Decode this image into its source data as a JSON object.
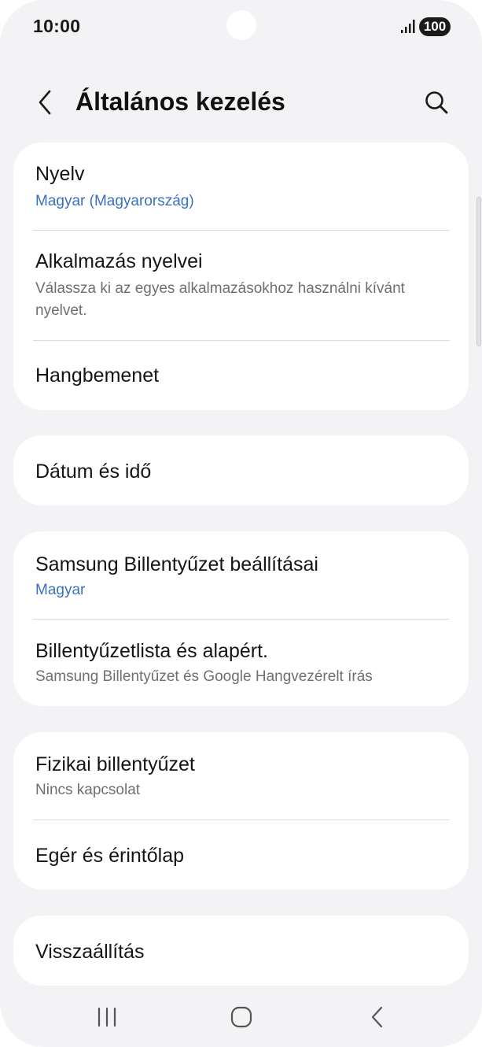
{
  "status_bar": {
    "time": "10:00",
    "battery": "100",
    "icons": [
      "signal-icon",
      "battery-icon",
      "camera-cutout"
    ]
  },
  "header": {
    "title": "Általános kezelés",
    "icons": [
      "back-arrow-icon",
      "search-icon"
    ]
  },
  "groups": [
    {
      "items": [
        {
          "title": "Nyelv",
          "subtitle": "Magyar (Magyarország)"
        },
        {
          "title": "Alkalmazás nyelvei",
          "subtitle": "Válassza ki az egyes alkalmazásokhoz használni kívánt nyelvet."
        },
        {
          "title": "Hangbemenet"
        }
      ]
    },
    {
      "items": [
        {
          "title": "Dátum és idő"
        }
      ]
    },
    {
      "items": [
        {
          "title": "Samsung Billentyűzet beállításai",
          "subtitle": "Magyar"
        },
        {
          "title": "Billentyűzetlista és alapért.",
          "subtitle": "Samsung Billentyűzet és Google Hangvezérelt írás"
        }
      ]
    },
    {
      "items": [
        {
          "title": "Fizikai billentyűzet",
          "subtitle": "Nincs kapcsolat"
        },
        {
          "title": "Egér és érintőlap"
        }
      ]
    },
    {
      "items": [
        {
          "title": "Visszaállítás"
        }
      ]
    }
  ],
  "nav_bar": {
    "icons": [
      "recent-apps-icon",
      "home-icon",
      "back-icon"
    ]
  },
  "colors": {
    "background": "#f3f3f5",
    "card": "#ffffff",
    "accent_subtitle": "#3a6fc2",
    "secondary_text": "#6f6f6f"
  }
}
